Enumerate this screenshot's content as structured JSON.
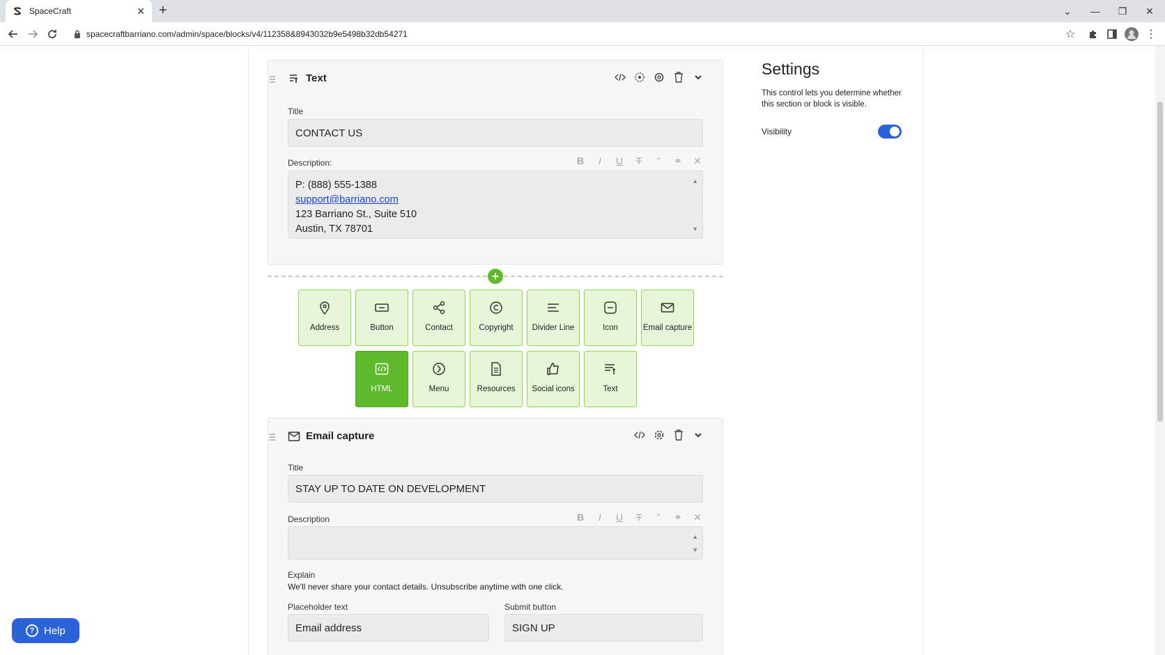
{
  "browser": {
    "tab_title": "SpaceCraft",
    "url": "spacecraftbarriano.com/admin/space/blocks/v4/112358&8943032b9e5498b32db54271"
  },
  "text_block": {
    "heading": "Text",
    "title_label": "Title",
    "title_value": "CONTACT US",
    "description_label": "Description:",
    "description_lines": {
      "phone": "P: (888) 555-1388",
      "email": "support@barriano.com",
      "street": "123 Barriano St., Suite 510",
      "city": "Austin, TX 78701"
    }
  },
  "rte_toolbar": {
    "bold": "B",
    "italic": "I",
    "underline": "U",
    "strike": "T",
    "quote": "”",
    "link": "⚭",
    "clear": "✕"
  },
  "tiles": {
    "address": "Address",
    "button": "Button",
    "contact": "Contact",
    "copyright": "Copyright",
    "divider_line": "Divider Line",
    "icon": "Icon",
    "email_capture": "Email capture",
    "html": "HTML",
    "menu": "Menu",
    "resources": "Resources",
    "social_icons": "Social icons",
    "text": "Text"
  },
  "email_block": {
    "heading": "Email capture",
    "title_label": "Title",
    "title_value": "STAY UP TO DATE ON DEVELOPMENT",
    "description_label": "Description",
    "explain_label": "Explain",
    "explain_text": "We'll never share your contact details. Unsubscribe anytime with one click.",
    "placeholder_label": "Placeholder text",
    "placeholder_value": "Email address",
    "submit_label": "Submit button",
    "submit_value": "SIGN UP"
  },
  "settings": {
    "title": "Settings",
    "description": "This control lets you determine whether this section or block is visible.",
    "visibility_label": "Visibility",
    "visibility_on": true
  },
  "help": {
    "label": "Help"
  },
  "colors": {
    "accent_green": "#5dbb2b",
    "tile_bg": "#e7f6d8",
    "toggle_blue": "#2a63d8",
    "link_blue": "#1a3fd6"
  }
}
